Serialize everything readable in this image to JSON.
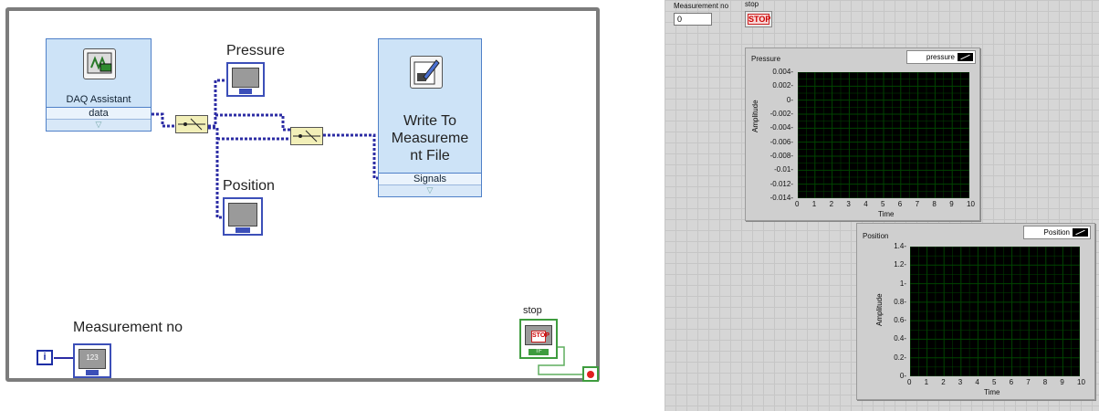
{
  "block_diagram": {
    "daq_label": "DAQ Assistant",
    "daq_terminal": "data",
    "pressure_label": "Pressure",
    "position_label": "Position",
    "write_title": "Write To Measureme nt File",
    "write_terminal": "Signals",
    "measurement_label": "Measurement no",
    "measurement_icon": "123",
    "iteration_symbol": "i",
    "stop_label": "stop",
    "stop_icon": "STOP",
    "stop_tf": "TF",
    "indicator_tag": "DBL",
    "wire_color": "#2c2ca4"
  },
  "front_panel": {
    "measurement_label": "Measurement no",
    "measurement_value": "0",
    "stop_label": "stop",
    "stop_button": "STOP",
    "plot_color": "#004400",
    "pressure_chart": {
      "title": "Pressure",
      "legend": "pressure",
      "yticks": [
        "0.004",
        "0.002",
        "0",
        "-0.002",
        "-0.004",
        "-0.006",
        "-0.008",
        "-0.01",
        "-0.012",
        "-0.014"
      ],
      "xticks": [
        "0",
        "1",
        "2",
        "3",
        "4",
        "5",
        "6",
        "7",
        "8",
        "9",
        "10"
      ],
      "ylabel": "Amplitude",
      "xlabel": "Time"
    },
    "position_chart": {
      "title": "Position",
      "legend": "Position",
      "yticks": [
        "1.4",
        "1.2",
        "1",
        "0.8",
        "0.6",
        "0.4",
        "0.2",
        "0"
      ],
      "xticks": [
        "0",
        "1",
        "2",
        "3",
        "4",
        "5",
        "6",
        "7",
        "8",
        "9",
        "10"
      ],
      "ylabel": "Amplitude",
      "xlabel": "Time"
    }
  }
}
